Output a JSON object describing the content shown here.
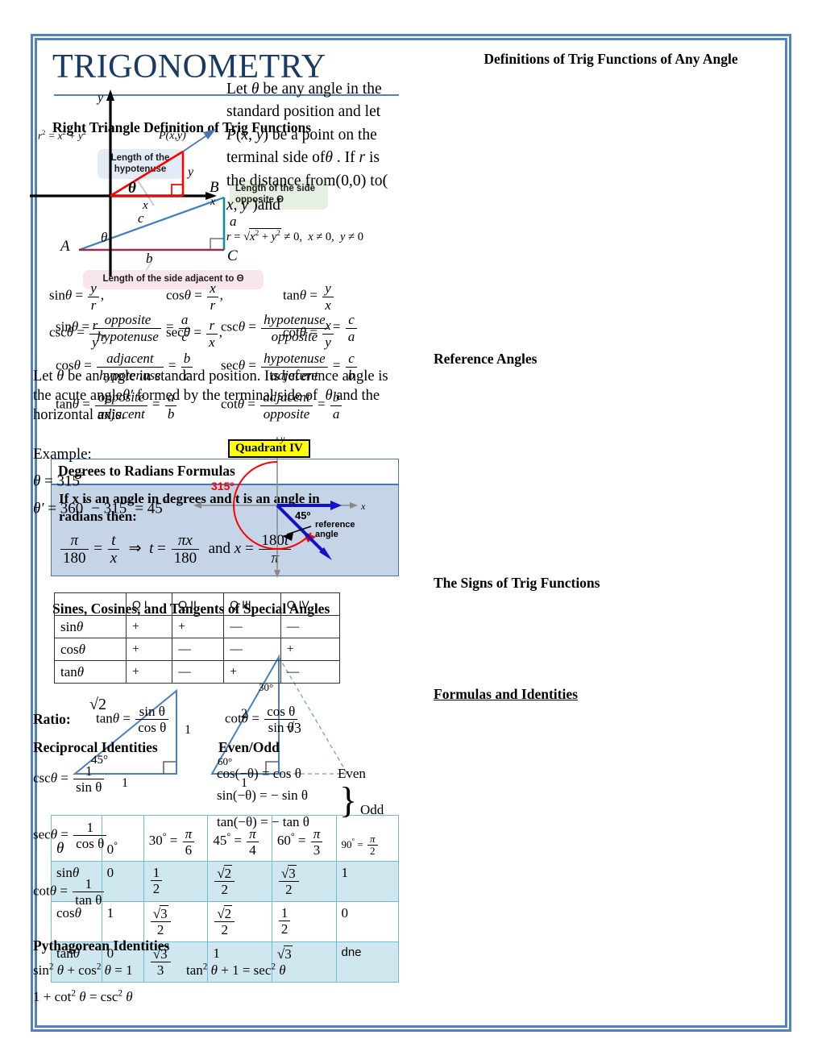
{
  "title": "TRIGONOMETRY",
  "left": {
    "right_triangle_heading": "Right Triangle Definition of Trig Functions",
    "triangle_figure": {
      "callout_hypotenuse": "Length of the hypotenuse",
      "callout_opposite": "Length of the side opposite Θ",
      "callout_adjacent": "Length of the side adjacent to Θ",
      "vertex_a": "A",
      "vertex_b": "B",
      "vertex_c": "C",
      "side_c": "c",
      "side_a": "a",
      "side_b": "b",
      "angle": "θ"
    },
    "ratios": [
      {
        "fn": "sin",
        "num": "opposite",
        "den": "hypotenuse",
        "snum": "a",
        "sden": "c"
      },
      {
        "fn": "csc",
        "num": "hypotenuse",
        "den": "opposite",
        "snum": "c",
        "sden": "a"
      },
      {
        "fn": "cos",
        "num": "adjacent",
        "den": "hypotenuse",
        "snum": "b",
        "sden": "c"
      },
      {
        "fn": "sec",
        "num": "hypotenuse",
        "den": "adjacent",
        "snum": "c",
        "sden": "b"
      },
      {
        "fn": "tan",
        "num": "opposite",
        "den": "adjacent",
        "snum": "a",
        "sden": "b"
      },
      {
        "fn": "cot",
        "num": "adjacent",
        "den": "opposite",
        "snum": "b",
        "sden": "a"
      }
    ],
    "degrees_box": {
      "header": "Degrees to Radians Formulas",
      "line1": "If  x is an angle in degrees and t is an angle in",
      "line2": "radians then:",
      "formula_plain": "π/180 = t/x  ⇒  t = πx/180  and  x = 180t/π",
      "and_word": "and"
    },
    "special_heading": "Sines, Cosines, and Tangents of Special Angles",
    "special_figure": {
      "tri45": {
        "hyp": "√2",
        "vert": "1",
        "base": "1",
        "angle": "45°"
      },
      "tri30": {
        "hyp": "2",
        "height": "√3",
        "base": "1",
        "angle_top": "30°",
        "angle_bottom": "60°"
      }
    },
    "special_table": {
      "corner": "θ",
      "columns": [
        "0°",
        "30° = π/6",
        "45° = π/4",
        "60° = π/3",
        "90° = π/2"
      ],
      "column_parts": [
        {
          "deg": "0",
          "frac_num": "",
          "frac_den": ""
        },
        {
          "deg": "30",
          "frac_num": "π",
          "frac_den": "6"
        },
        {
          "deg": "45",
          "frac_num": "π",
          "frac_den": "4"
        },
        {
          "deg": "60",
          "frac_num": "π",
          "frac_den": "3"
        },
        {
          "deg": "90",
          "frac_num": "π",
          "frac_den": "2"
        }
      ],
      "rows": [
        {
          "label": "sin",
          "values": [
            "0",
            "1/2",
            "√2/2",
            "√3/2",
            "1"
          ]
        },
        {
          "label": "cos",
          "values": [
            "1",
            "√3/2",
            "√2/2",
            "1/2",
            "0"
          ]
        },
        {
          "label": "tan",
          "values": [
            "0",
            "√3/3",
            "1",
            "√3",
            "dne"
          ]
        }
      ]
    }
  },
  "right": {
    "def_heading": "Definitions of Trig Functions of Any Angle",
    "axes_figure": {
      "y_axis": "y",
      "x_axis": "x",
      "point_label": "P(x,y)",
      "angle": "θ",
      "leg_y": "y",
      "leg_x": "x",
      "pythag": "r² = x² + y²"
    },
    "def_text": "Let θ be any angle in the standard position and let P(x, y) be a point on the terminal side of θ. If r is the distance from (0,0) to (x, y) and",
    "r_formula": "r = √(x² + y²) ≠ 0,  x ≠ 0,  y ≠ 0",
    "any_angle_defs": [
      {
        "fn": "sin",
        "num": "y",
        "den": "r"
      },
      {
        "fn": "cos",
        "num": "x",
        "den": "r"
      },
      {
        "fn": "tan",
        "num": "y",
        "den": "x"
      },
      {
        "fn": "csc",
        "num": "r",
        "den": "y"
      },
      {
        "fn": "sec",
        "num": "r",
        "den": "x"
      },
      {
        "fn": "cot",
        "num": "x",
        "den": "y"
      }
    ],
    "reference_heading": "Reference Angles",
    "reference_text": "Let θ be an angle in standard position. Its reference angle is the acute angle θ′ formed by the terminal side of θ and the horizontal axis.",
    "example_label": "Example:",
    "example_theta": "θ = 315°",
    "example_thetap": "θ′ = 360° − 315° = 45°",
    "quadrant_figure": {
      "badge": "Quadrant IV",
      "sweep_label": "315º",
      "ref_label": "45º",
      "ref_text_1": "reference",
      "ref_text_2": "angle",
      "y_axis": "y",
      "x_axis": "x"
    },
    "signs_heading": "The Signs of Trig Functions",
    "signs_table": {
      "columns": [
        "Q I",
        "Q II",
        "Q III",
        "Q IV"
      ],
      "rows": [
        {
          "label": "sin",
          "values": [
            "+",
            "+",
            "—",
            "—"
          ]
        },
        {
          "label": "cos",
          "values": [
            "+",
            "—",
            "—",
            "+"
          ]
        },
        {
          "label": "tan",
          "values": [
            "+",
            "—",
            "+",
            "—"
          ]
        }
      ]
    },
    "identities_heading": "Formulas and Identities",
    "ratio_label": "Ratio:",
    "ratio_formulas": [
      {
        "fn": "tan",
        "num": "sin θ",
        "den": "cos θ"
      },
      {
        "fn": "cot",
        "num": "cos θ",
        "den": "sin θ"
      }
    ],
    "reciprocal_heading": "Reciprocal Identities",
    "reciprocal_formulas": [
      {
        "fn": "csc",
        "den": "sin θ"
      },
      {
        "fn": "sec",
        "den": "cos θ"
      },
      {
        "fn": "cot",
        "den": "tan θ"
      }
    ],
    "evenodd_heading": "Even/Odd",
    "evenodd": {
      "even_formula": "cos(−θ) = cos θ",
      "even_label": "Even",
      "odd_formula_1": "sin(−θ) = − sin θ",
      "odd_formula_2": "tan(−θ) = − tan θ",
      "odd_label": "Odd"
    },
    "pythagorean_heading": "Pythagorean Identities",
    "pythagorean": [
      "sin² θ + cos² θ = 1",
      "tan² θ + 1 = sec² θ",
      "1 + cot² θ = csc² θ"
    ]
  },
  "colors": {
    "border": "#5182bf",
    "title": "#1b3a63",
    "box_fill": "#c6d4e8",
    "table_fill": "#cfe8ef",
    "table_border": "#74bcd4",
    "triangle_hyp": "#3a7fc1",
    "triangle_opp": "#0d8f8f",
    "triangle_adj": "#9e2a52",
    "vector_red": "#ff0000",
    "vector_blue": "#4a74b8",
    "quadrant_badge": "#ffff00"
  }
}
